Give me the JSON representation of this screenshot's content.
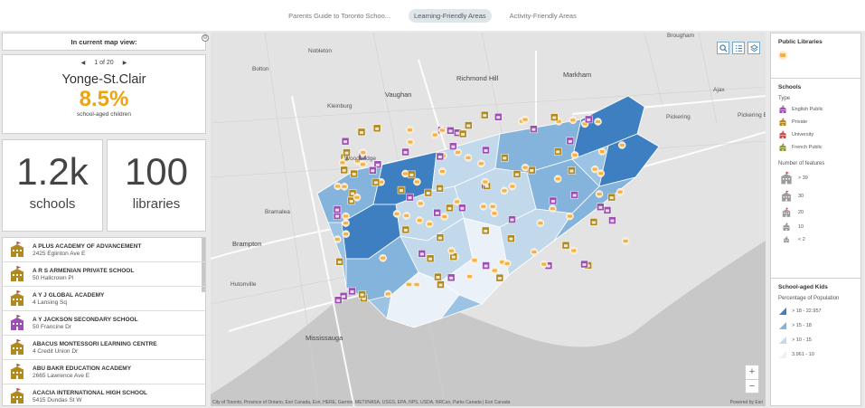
{
  "tabs": [
    {
      "label": "Parents Guide to Toronto Schoo...",
      "active": false
    },
    {
      "label": "Learning-Friendly Areas",
      "active": true
    },
    {
      "label": "Activity-Friendly Areas",
      "active": false
    }
  ],
  "left": {
    "in_view_label": "In current map view:",
    "collapse_icon": "⊖",
    "pager": {
      "text": "1 of 20"
    },
    "area": {
      "name": "Yonge-St.Clair",
      "value": "8.5%",
      "caption": "school-aged children"
    },
    "stats": [
      {
        "value": "1.2k",
        "label": "schools"
      },
      {
        "value": "100",
        "label": "libraries"
      }
    ],
    "schools": [
      {
        "name": "A PLUS ACADEMY OF ADVANCEMENT",
        "address": "2425 Eglinton Ave E",
        "type": "private"
      },
      {
        "name": "A R S ARMENIAN PRIVATE SCHOOL",
        "address": "50 Hallcrown Pl",
        "type": "private"
      },
      {
        "name": "A Y J GLOBAL ACADEMY",
        "address": "4 Lansing Sq",
        "type": "private"
      },
      {
        "name": "A Y JACKSON SECONDARY SCHOOL",
        "address": "50 Francine Dr",
        "type": "english"
      },
      {
        "name": "ABACUS MONTESSORI LEARNING CENTRE",
        "address": "4 Credit Union Dr",
        "type": "private"
      },
      {
        "name": "ABU BAKR EDUCATION ACADEMY",
        "address": "2665 Lawrence Ave E",
        "type": "private"
      },
      {
        "name": "ACACIA INTERNATIONAL HIGH SCHOOL",
        "address": "5415 Dundas St W",
        "type": "private"
      }
    ]
  },
  "map": {
    "places": [
      {
        "name": "Bolton",
        "big": false
      },
      {
        "name": "Nobleton",
        "big": false
      },
      {
        "name": "Richmond Hill",
        "big": true
      },
      {
        "name": "Markham",
        "big": true
      },
      {
        "name": "Vaughan",
        "big": true
      },
      {
        "name": "Kleinburg",
        "big": false
      },
      {
        "name": "Woodbridge",
        "big": false
      },
      {
        "name": "Pickering",
        "big": false
      },
      {
        "name": "Ajax",
        "big": false
      },
      {
        "name": "Brampton",
        "big": true
      },
      {
        "name": "Bramalea",
        "big": false
      },
      {
        "name": "Mississauga",
        "big": true
      },
      {
        "name": "Hutonville",
        "big": false
      },
      {
        "name": "Brougham",
        "big": false
      },
      {
        "name": "Pickering Bea",
        "big": false
      }
    ],
    "attribution": "City of Toronto, Province of Ontario, Esri Canada, Esri, HERE, Garmin, METI/NASA, USGS, EPA, NPS, USDA, NRCan, Parks Canada | Esri Canada",
    "powered_by": "Powered by Esri",
    "zoom_in": "+",
    "zoom_out": "−",
    "tools": [
      "search-icon",
      "legend-list-icon",
      "layers-icon"
    ]
  },
  "legend": {
    "libraries": {
      "title": "Public Libraries",
      "color": "#f5b042"
    },
    "schools": {
      "title": "Schools",
      "type_label": "Type",
      "types": [
        {
          "label": "English Public",
          "color": "#9b4fb0"
        },
        {
          "label": "Private",
          "color": "#b08a1f"
        },
        {
          "label": "University",
          "color": "#c0504d"
        },
        {
          "label": "French Public",
          "color": "#8a9a3a"
        }
      ],
      "count_label": "Number of features",
      "counts": [
        "> 39",
        "30",
        "20",
        "10",
        "< 2"
      ]
    },
    "kids": {
      "title": "School-aged Kids",
      "sub": "Percentage of Population",
      "classes": [
        {
          "label": "> 18 - 22.957",
          "color": "#3d7fc1"
        },
        {
          "label": "> 15 - 18",
          "color": "#84b4db"
        },
        {
          "label": "> 10 - 15",
          "color": "#c2d9ec"
        },
        {
          "label": "3.961 - 10",
          "color": "#eaf1f8"
        }
      ]
    }
  }
}
